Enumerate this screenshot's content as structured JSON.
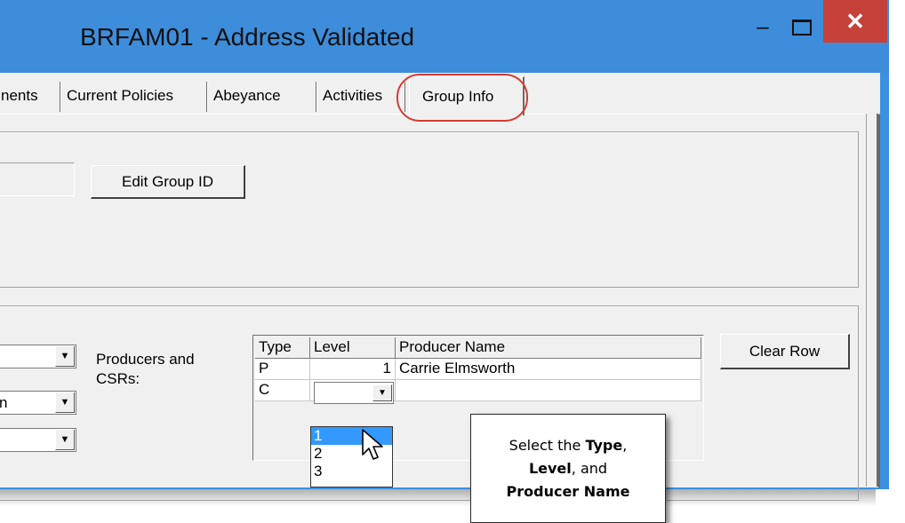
{
  "window": {
    "title": "BRFAM01 - Address Validated",
    "close_glyph": "✕",
    "minimize_glyph": "–"
  },
  "tabs": [
    {
      "label": "nents",
      "active": false
    },
    {
      "label": "Current Policies",
      "active": false
    },
    {
      "label": "Abeyance",
      "active": false
    },
    {
      "label": "Activities",
      "active": false
    },
    {
      "label": "Group Info",
      "active": true
    }
  ],
  "group_section": {
    "edit_button": "Edit Group ID"
  },
  "producers": {
    "label_line1": "Producers and",
    "label_line2": "CSRs:",
    "left_combos": [
      "",
      "n",
      ""
    ],
    "columns": [
      "Type",
      "Level",
      "Producer Name"
    ],
    "rows": [
      {
        "type": "P",
        "level": "1",
        "name": "Carrie Elmsworth"
      },
      {
        "type": "C",
        "level": "",
        "name": ""
      }
    ],
    "level_options": [
      "1",
      "2",
      "3"
    ],
    "selected_level_option": "1",
    "clear_button": "Clear Row"
  },
  "callout": {
    "prefix": "Select the ",
    "bold1": "Type",
    "mid1": ",",
    "bold2": "Level",
    "mid2": ", and",
    "bold3": "Producer Name"
  },
  "colors": {
    "titlebar": "#3d8ddb",
    "close_button": "#c7413b",
    "highlight_circle": "#d63a30",
    "selection": "#3399ff"
  }
}
